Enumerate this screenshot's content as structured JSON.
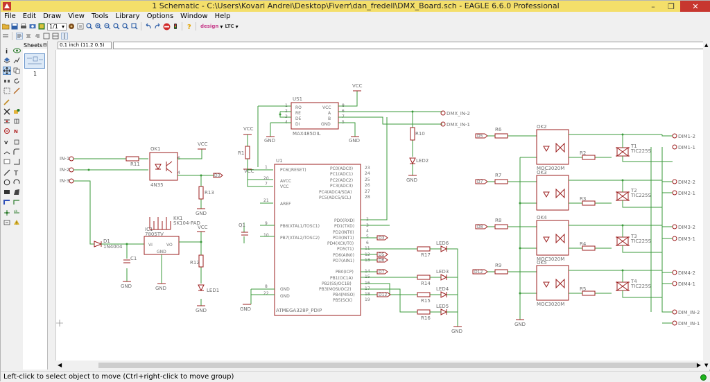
{
  "window": {
    "title": "1 Schematic - C:\\Users\\Kovari Andrei\\Desktop\\Fiverr\\dan_fredell\\DMX_Board.sch - EAGLE 6.6.0 Professional",
    "minimize": "–",
    "maximize": "❐",
    "close": "✕"
  },
  "menu": [
    "File",
    "Edit",
    "Draw",
    "View",
    "Tools",
    "Library",
    "Options",
    "Window",
    "Help"
  ],
  "toolbar": {
    "sheet_combo": "1/1",
    "design_logo": "design",
    "ltc_logo": "LTC"
  },
  "sheets_panel": {
    "title": "Sheets",
    "sheet_number": "1"
  },
  "coord": {
    "value": "0.1 inch (11.2 0.5)"
  },
  "status": {
    "message": "Left-click to select object to move (Ctrl+right-click to move group)"
  },
  "colors": {
    "titlebar": "#f4df6a",
    "wire": "#3a9a3a",
    "part": "#9b1c1c",
    "label": "#6f6f6f",
    "status_ok": "#1db51d"
  },
  "schematic": {
    "inputs": [
      "IN-1",
      "IN-2",
      "IN-3"
    ],
    "outputs": [
      "DIM1-2",
      "DIM1-1",
      "DIM2-2",
      "DIM2-1",
      "DIM3-2",
      "DIM3-1",
      "DIM4-2",
      "DIM4-1",
      "DIM_IN-2",
      "DIM_IN-1"
    ],
    "dmx_outputs": [
      "DMX_IN-2",
      "DMX_IN-1"
    ],
    "parts": {
      "u1": "U1",
      "u1_value": "ATMEGA328P_PDIP",
      "u1_left_pins": [
        "PC6(/RESET)",
        "AVCC",
        "VCC",
        "AREF",
        "PB6(XTAL1/TOSC1)",
        "PB7(XTAL2/TOSC2)",
        "GND",
        "GND"
      ],
      "u1_left_nums": [
        "1",
        "20",
        "7",
        "21",
        "9",
        "10",
        "8",
        "22"
      ],
      "u1_right_pins": [
        "PC0(ADC0)",
        "PC1(ADC1)",
        "PC2(ADC2)",
        "PC3(ADC3)",
        "PC4(ADC4/SDA)",
        "PC5(ADC5/SCL)",
        "PD0(RXD)",
        "PD1(TXD)",
        "PD2(INT0)",
        "PD3(INT1)",
        "PD4(XCK/T0)",
        "PD5(T1)",
        "PD6(AIN0)",
        "PD7(AIN1)",
        "PB0(ICP)",
        "PB1(OC1A)",
        "PB2(SS/OC1B)",
        "PB3(MOSI/OC2)",
        "PB4(MISO)",
        "PB5(SCK)"
      ],
      "u1_right_nums": [
        "23",
        "24",
        "25",
        "26",
        "27",
        "28",
        "2",
        "3",
        "4",
        "5",
        "6",
        "11",
        "12",
        "13",
        "14",
        "15",
        "16",
        "17",
        "18",
        "19"
      ],
      "us1": "US1",
      "us1_value": "MAX485DIL",
      "us1_left": [
        "RO",
        "RE",
        "DE",
        "DI"
      ],
      "us1_left_nums": [
        "1",
        "2",
        "3",
        "4"
      ],
      "us1_right": [
        "VCC",
        "A",
        "B",
        "GND"
      ],
      "us1_right_nums": [
        "8",
        "6",
        "7",
        "5"
      ],
      "ok1": "OK1",
      "ok1_value": "4N35",
      "ok_names": [
        "OK2",
        "OK3",
        "OK4",
        "OK5"
      ],
      "moc": "MOC3020M",
      "triacs": [
        "T1",
        "T2",
        "T3",
        "T4"
      ],
      "tic": "TIC225S",
      "r_left": [
        "R6",
        "R7",
        "R8",
        "R9"
      ],
      "r_right": [
        "R2",
        "R3",
        "R4",
        "R5"
      ],
      "r11": "R11",
      "r13": "R13",
      "r12": "R12",
      "r1": "R1",
      "r10": "R10",
      "r_leds": [
        "R17",
        "R14",
        "R15",
        "R16"
      ],
      "leds": [
        "LED6",
        "LED3",
        "LED4",
        "LED5"
      ],
      "led1": "LED1",
      "led2": "LED2",
      "d1": "D1",
      "d1_value": "1N4004",
      "c1": "C1",
      "q1": "Q1",
      "ic1": "IC1",
      "ic1_value": "7805TV",
      "ic1_vi": "VI",
      "ic1_vo": "VO",
      "ic1_gnd": "GND",
      "kk1": "KK1",
      "kk1_value": "SK104-PAD",
      "vcc": "VCC",
      "gnd": "GND",
      "net_tags_left": [
        "D5",
        "D6",
        "D7",
        "D8",
        "D12"
      ],
      "net_tags_u1": [
        "D3",
        "D5",
        "D6",
        "D7",
        "D8",
        "D12"
      ],
      "net_tag_ok1": "D3",
      "pin_nums": [
        "1",
        "2",
        "4",
        "6",
        "4",
        "6"
      ]
    }
  }
}
